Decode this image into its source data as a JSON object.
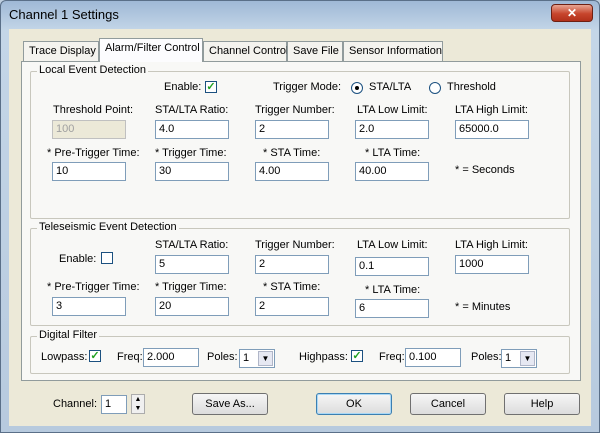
{
  "window": {
    "title": "Channel 1 Settings",
    "close_glyph": "✕"
  },
  "tabs": [
    {
      "label": "Trace Display"
    },
    {
      "label": "Alarm/Filter Control"
    },
    {
      "label": "Channel Control"
    },
    {
      "label": "Save File"
    },
    {
      "label": "Sensor Information"
    }
  ],
  "local": {
    "legend": "Local Event Detection",
    "enable_label": "Enable:",
    "enable_checked": "✓",
    "trigger_mode_label": "Trigger Mode:",
    "mode_sta_lta": "STA/LTA",
    "mode_threshold": "Threshold",
    "threshold_point_label": "Threshold Point:",
    "threshold_point": "100",
    "sta_lta_ratio_label": "STA/LTA Ratio:",
    "sta_lta_ratio": "4.0",
    "trigger_number_label": "Trigger Number:",
    "trigger_number": "2",
    "lta_low_label": "LTA Low Limit:",
    "lta_low": "2.0",
    "lta_high_label": "LTA High Limit:",
    "lta_high": "65000.0",
    "pre_trigger_label": "* Pre-Trigger Time:",
    "pre_trigger": "10",
    "trigger_time_label": "* Trigger Time:",
    "trigger_time": "30",
    "sta_time_label": "* STA Time:",
    "sta_time": "4.00",
    "lta_time_label": "* LTA Time:",
    "lta_time": "40.00",
    "units_note": "* = Seconds"
  },
  "tele": {
    "legend": "Teleseismic Event Detection",
    "enable_label": "Enable:",
    "sta_lta_ratio_label": "STA/LTA Ratio:",
    "sta_lta_ratio": "5",
    "trigger_number_label": "Trigger Number:",
    "trigger_number": "2",
    "lta_low_label": "LTA Low Limit:",
    "lta_low": "0.1",
    "lta_high_label": "LTA High Limit:",
    "lta_high": "1000",
    "pre_trigger_label": "* Pre-Trigger Time:",
    "pre_trigger": "3",
    "trigger_time_label": "* Trigger Time:",
    "trigger_time": "20",
    "sta_time_label": "* STA Time:",
    "sta_time": "2",
    "lta_time_label": "* LTA Time:",
    "lta_time": "6",
    "units_note": "* = Minutes"
  },
  "filter": {
    "legend": "Digital Filter",
    "lowpass_label": "Lowpass:",
    "lowpass_checked": "✓",
    "low_freq_label": "Freq:",
    "low_freq": "2.000",
    "low_poles_label": "Poles:",
    "low_poles": "1",
    "highpass_label": "Highpass:",
    "highpass_checked": "✓",
    "high_freq_label": "Freq:",
    "high_freq": "0.100",
    "high_poles_label": "Poles:",
    "high_poles": "1"
  },
  "footer": {
    "channel_label": "Channel:",
    "channel_value": "1",
    "save_as": "Save As...",
    "ok": "OK",
    "cancel": "Cancel",
    "help": "Help"
  }
}
